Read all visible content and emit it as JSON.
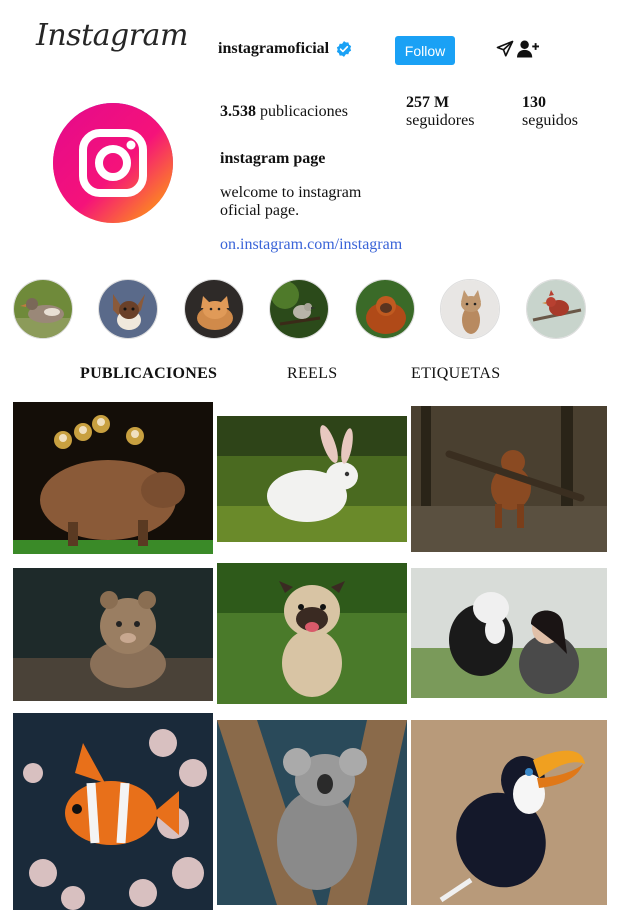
{
  "header": {
    "logo_text": "Instagram",
    "username": "instagramoficial",
    "follow_label": "Follow"
  },
  "profile": {
    "posts_count": "3.538",
    "posts_label": "publicaciones",
    "followers_count": "257 M",
    "followers_label": "seguidores",
    "following_count": "130",
    "following_label": "seguidos",
    "display_name": "instagram page",
    "bio_line1": "welcome to instagram",
    "bio_line2": "oficial page.",
    "link": "on.instagram.com/instagram"
  },
  "tabs": [
    "PUBLICACIONES",
    "REELS",
    "ETIQUETAS"
  ],
  "colors": {
    "follow_button": "#1aa1f5",
    "link": "#3a64d8",
    "verified_badge": "#1aa1f5"
  },
  "icons": {
    "send": "send-icon",
    "add_user": "add-user-icon",
    "verified": "verified-badge-icon"
  }
}
